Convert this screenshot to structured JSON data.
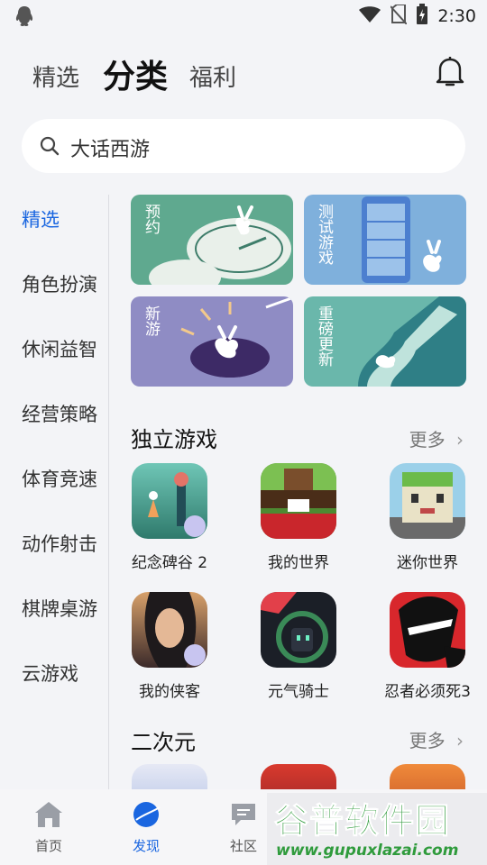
{
  "status_bar": {
    "time": "2:30"
  },
  "top_tabs": {
    "featured": "精选",
    "category": "分类",
    "welfare": "福利"
  },
  "search": {
    "value": "大话西游"
  },
  "sidebar": {
    "items": [
      "精选",
      "角色扮演",
      "休闲益智",
      "经营策略",
      "体育竞速",
      "动作射击",
      "棋牌桌游",
      "云游戏"
    ],
    "active_index": 0
  },
  "banners": [
    {
      "label": "预约",
      "color": "#5fa98f"
    },
    {
      "label": "测试游戏",
      "color": "#7fb0dc"
    },
    {
      "label": "新游",
      "color": "#8f8cc4"
    },
    {
      "label": "重磅更新",
      "color": "#6ab7ab"
    }
  ],
  "sections": [
    {
      "title": "独立游戏",
      "more": "更多",
      "games": [
        "纪念碑谷 2",
        "我的世界",
        "迷你世界",
        "我的侠客",
        "元气骑士",
        "忍者必须死3"
      ]
    },
    {
      "title": "二次元",
      "more": "更多"
    }
  ],
  "bottom_nav": {
    "items": [
      "首页",
      "发现",
      "社区"
    ],
    "active_index": 1
  },
  "watermark": {
    "text": "谷普软件园",
    "url": "www.gupuxlazai.com"
  },
  "colors": {
    "accent": "#1a66e0",
    "background": "#f3f4f7"
  }
}
